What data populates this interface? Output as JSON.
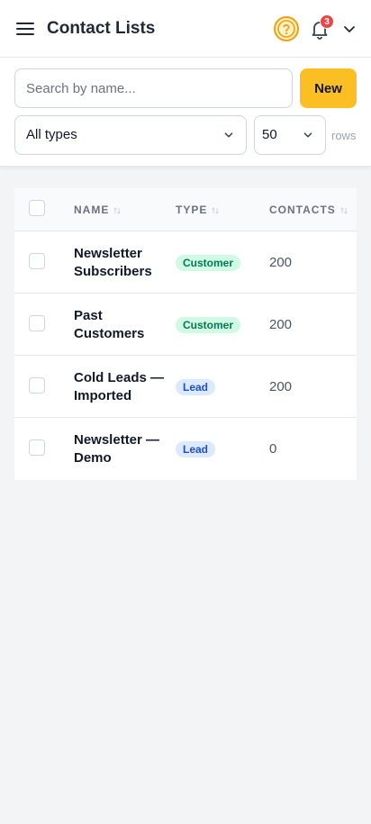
{
  "header": {
    "menu_icon": "hamburger-icon",
    "title": "Contact Lists",
    "help_icon": "question-circle-icon",
    "notification_count": "3",
    "bell_icon": "bell-icon",
    "account_menu_icon": "chevron-down-icon",
    "help_color": "#f59e0b"
  },
  "filters": {
    "search_placeholder": "Search by name...",
    "new_label": "New",
    "type_select_value": "All types",
    "rows_select_value": "50",
    "rows_label": "rows",
    "accent_color": "#fbbf24"
  },
  "table": {
    "columns": [
      "NAME",
      "TYPE",
      "CONTACTS"
    ],
    "rows": [
      {
        "name": "Newsletter Subscribers",
        "type": "Customer",
        "contacts": "200"
      },
      {
        "name": "Past Customers",
        "type": "Customer",
        "contacts": "200"
      },
      {
        "name": "Cold Leads — Imported",
        "type": "Lead",
        "contacts": "200"
      },
      {
        "name": "Newsletter — Demo",
        "type": "Lead",
        "contacts": "0"
      }
    ]
  }
}
